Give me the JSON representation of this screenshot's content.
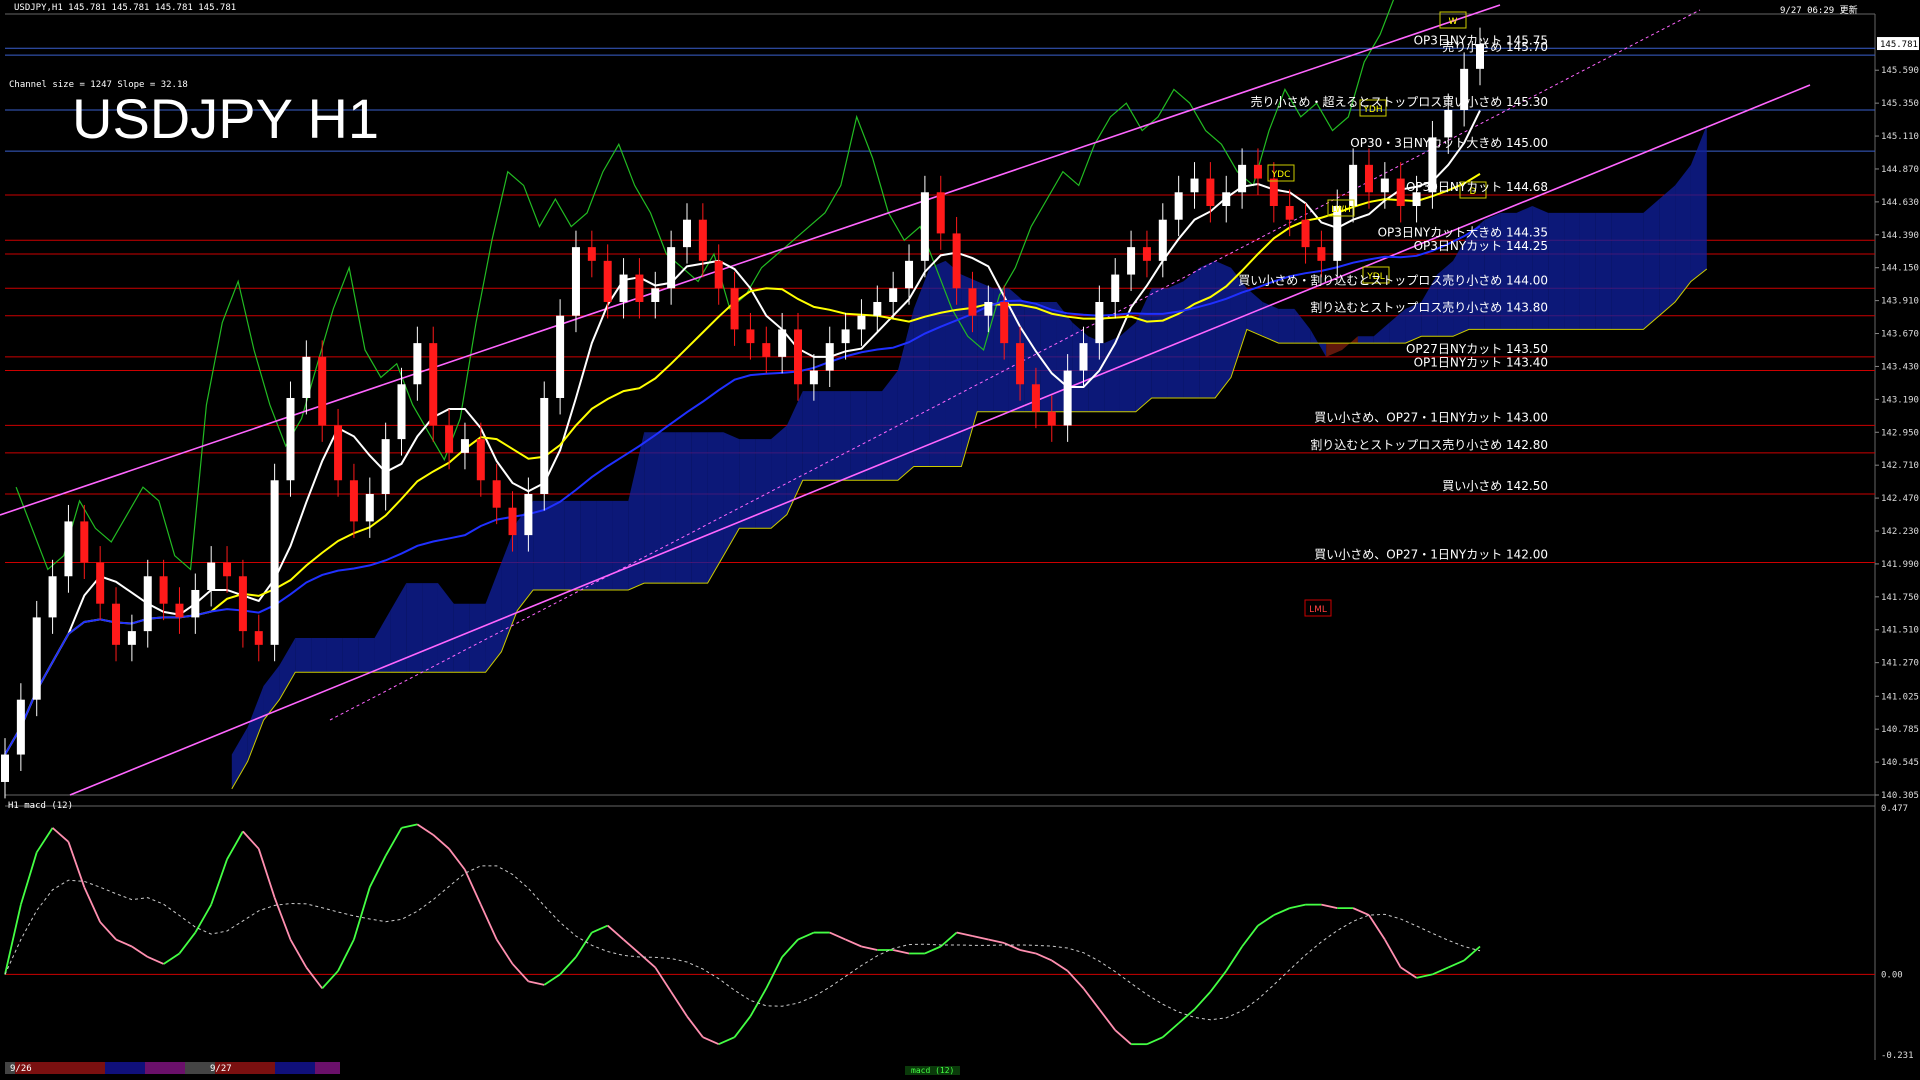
{
  "window": {
    "header": "USDJPY,H1  145.781 145.781 145.781 145.781",
    "timestamp": "9/27 06:29 更新",
    "big_title": "USDJPY H1",
    "channel_info": "Channel size = 1247 Slope = 32.18",
    "indicator_label": "H1  macd (12)",
    "status_tab": "macd (12)"
  },
  "colors": {
    "background": "#000000",
    "bull_candle": "#ffffff",
    "bear_candle": "#ff1a1a",
    "ma_white": "#ffffff",
    "ma_yellow": "#ffff00",
    "ma_blue": "#2030ff",
    "channel": "#ff66ff",
    "level_red": "#cc0000",
    "level_blue": "#3a5fcd",
    "macd_up": "#44ff44",
    "macd_down": "#ff8fb0",
    "signal": "#cccccc",
    "lagging_span": "#22bb22",
    "cloud_bull": "#1020a0",
    "cloud_bear": "#802010"
  },
  "chart_data": {
    "type": "line",
    "title": "USDJPY H1",
    "price_axis": {
      "ylim": [
        140.305,
        146.0
      ],
      "ticks": [
        "145.590",
        "145.350",
        "145.110",
        "144.870",
        "144.630",
        "144.390",
        "144.150",
        "143.910",
        "143.670",
        "143.430",
        "143.190",
        "142.950",
        "142.710",
        "142.470",
        "142.230",
        "141.990",
        "141.750",
        "141.510",
        "141.270",
        "141.025",
        "140.785",
        "140.545",
        "140.305"
      ],
      "current_price": "145.781"
    },
    "close_series": [
      140.6,
      141.0,
      141.6,
      141.9,
      142.3,
      142.0,
      141.7,
      141.4,
      141.5,
      141.9,
      141.7,
      141.6,
      141.8,
      142.0,
      141.9,
      141.5,
      141.4,
      142.6,
      143.2,
      143.5,
      143.0,
      142.6,
      142.3,
      142.5,
      142.9,
      143.3,
      143.6,
      143.0,
      142.8,
      142.9,
      142.6,
      142.4,
      142.2,
      142.5,
      143.2,
      143.8,
      144.3,
      144.2,
      143.9,
      144.1,
      143.9,
      144.0,
      144.3,
      144.5,
      144.2,
      144.0,
      143.7,
      143.6,
      143.5,
      143.7,
      143.3,
      143.4,
      143.6,
      143.7,
      143.8,
      143.9,
      144.0,
      144.2,
      144.7,
      144.4,
      144.0,
      143.8,
      143.9,
      143.6,
      143.3,
      143.1,
      143.0,
      143.4,
      143.6,
      143.9,
      144.1,
      144.3,
      144.2,
      144.5,
      144.7,
      144.8,
      144.6,
      144.7,
      144.9,
      144.8,
      144.6,
      144.5,
      144.3,
      144.2,
      144.6,
      144.9,
      144.7,
      144.8,
      144.6,
      144.7,
      145.1,
      145.3,
      145.6,
      145.781
    ],
    "macd": {
      "ylim": [
        -0.231,
        0.477
      ],
      "ticks": [
        "0.477",
        "0.00",
        "-0.231"
      ],
      "values": [
        0.0,
        0.2,
        0.35,
        0.42,
        0.38,
        0.25,
        0.15,
        0.1,
        0.08,
        0.05,
        0.03,
        0.06,
        0.12,
        0.2,
        0.33,
        0.41,
        0.36,
        0.22,
        0.1,
        0.02,
        -0.04,
        0.01,
        0.1,
        0.25,
        0.34,
        0.42,
        0.43,
        0.4,
        0.36,
        0.3,
        0.2,
        0.1,
        0.03,
        -0.02,
        -0.03,
        0.0,
        0.05,
        0.12,
        0.14,
        0.1,
        0.06,
        0.02,
        -0.05,
        -0.12,
        -0.18,
        -0.2,
        -0.18,
        -0.12,
        -0.04,
        0.05,
        0.1,
        0.12,
        0.12,
        0.1,
        0.08,
        0.07,
        0.07,
        0.06,
        0.06,
        0.08,
        0.12,
        0.11,
        0.1,
        0.09,
        0.07,
        0.06,
        0.04,
        0.01,
        -0.04,
        -0.1,
        -0.16,
        -0.2,
        -0.2,
        -0.18,
        -0.14,
        -0.1,
        -0.05,
        0.01,
        0.08,
        0.14,
        0.17,
        0.19,
        0.2,
        0.2,
        0.19,
        0.19,
        0.17,
        0.1,
        0.02,
        -0.01,
        0.0,
        0.02,
        0.04,
        0.08
      ]
    },
    "levels": [
      {
        "price": 145.75,
        "label": "OP3日NYカット 145.75",
        "color": "#3a5fcd"
      },
      {
        "price": 145.7,
        "label": "売り小さめ 145.70",
        "color": "#3a5fcd"
      },
      {
        "price": 145.3,
        "label": "売り小さめ・超えるとストップロス買い小さめ 145.30",
        "color": "#3a5fcd"
      },
      {
        "price": 145.0,
        "label": "OP30・3日NYカット大きめ 145.00",
        "color": "#3a5fcd"
      },
      {
        "price": 144.68,
        "label": "OP30日NYカット 144.68",
        "color": "#cc0000"
      },
      {
        "price": 144.35,
        "label": "OP3日NYカット大きめ 144.35",
        "color": "#cc0000"
      },
      {
        "price": 144.25,
        "label": "OP3日NYカット 144.25",
        "color": "#cc0000"
      },
      {
        "price": 144.0,
        "label": "買い小さめ・割り込むとストップロス売り小さめ 144.00",
        "color": "#cc0000"
      },
      {
        "price": 143.8,
        "label": "割り込むとストップロス売り小さめ 143.80",
        "color": "#cc0000"
      },
      {
        "price": 143.5,
        "label": "OP27日NYカット 143.50",
        "color": "#cc0000"
      },
      {
        "price": 143.4,
        "label": "OP1日NYカット 143.40",
        "color": "#cc0000"
      },
      {
        "price": 143.0,
        "label": "買い小さめ、OP27・1日NYカット 143.00",
        "color": "#cc0000"
      },
      {
        "price": 142.8,
        "label": "割り込むとストップロス売り小さめ 142.80",
        "color": "#cc0000"
      },
      {
        "price": 142.5,
        "label": "買い小さめ 142.50",
        "color": "#cc0000"
      },
      {
        "price": 142.0,
        "label": "買い小さめ、OP27・1日NYカット 142.00",
        "color": "#cc0000"
      }
    ],
    "markers": [
      "YDH",
      "YDC",
      "YDL",
      "LWH",
      "LML",
      "W",
      "D"
    ],
    "x_labels": [
      "9/26",
      "9/27"
    ]
  }
}
